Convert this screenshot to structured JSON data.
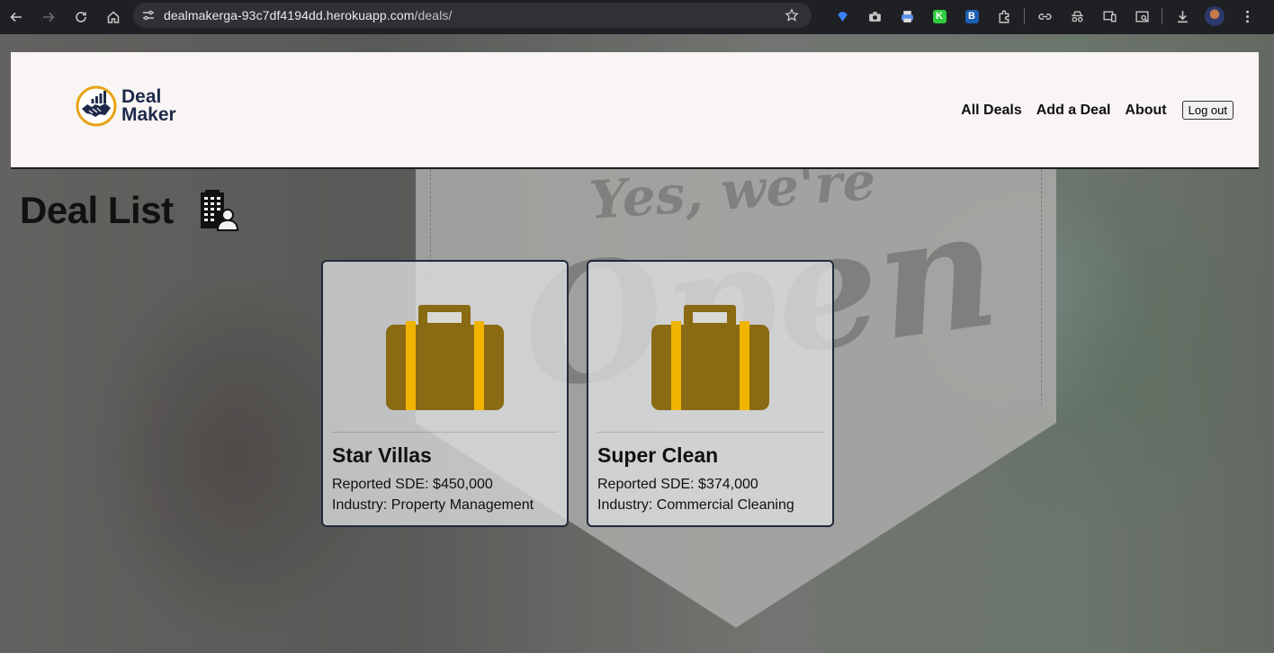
{
  "browser": {
    "url_host": "dealmakerga-93c7df4194dd.herokuapp.com",
    "url_path": "/deals/"
  },
  "icons": {
    "back": "arrow-left-icon",
    "forward": "arrow-right-icon",
    "reload": "reload-icon",
    "home": "home-icon",
    "site_info": "tune-icon",
    "bookmark": "star-icon"
  },
  "extensions": [
    "gem-icon",
    "camera-icon",
    "printer-icon",
    "K",
    "B",
    "puzzle-icon",
    "link-icon",
    "spy-icon",
    "devices-icon",
    "search-page-icon",
    "download-icon",
    "avatar",
    "more-icon"
  ],
  "header": {
    "logo_line1": "Deal",
    "logo_line2": "Maker",
    "nav": [
      {
        "label": "All Deals"
      },
      {
        "label": "Add a Deal"
      },
      {
        "label": "About"
      }
    ],
    "logout_label": "Log out"
  },
  "main": {
    "title": "Deal List",
    "deals": [
      {
        "name": "Star Villas",
        "sde": "Reported SDE: $450,000",
        "industry": "Industry: Property Management"
      },
      {
        "name": "Super Clean",
        "sde": "Reported SDE: $374,000",
        "industry": "Industry: Commercial Cleaning"
      }
    ]
  },
  "background": {
    "banner_line1": "Yes, we're",
    "banner_line2": "Open"
  },
  "colors": {
    "briefcase_body": "#8a6a12",
    "briefcase_stripe": "#f0b400",
    "navbar_bg": "#f8f5f4",
    "logo_blue": "#1e2a4a",
    "logo_ring": "#e8a317"
  }
}
